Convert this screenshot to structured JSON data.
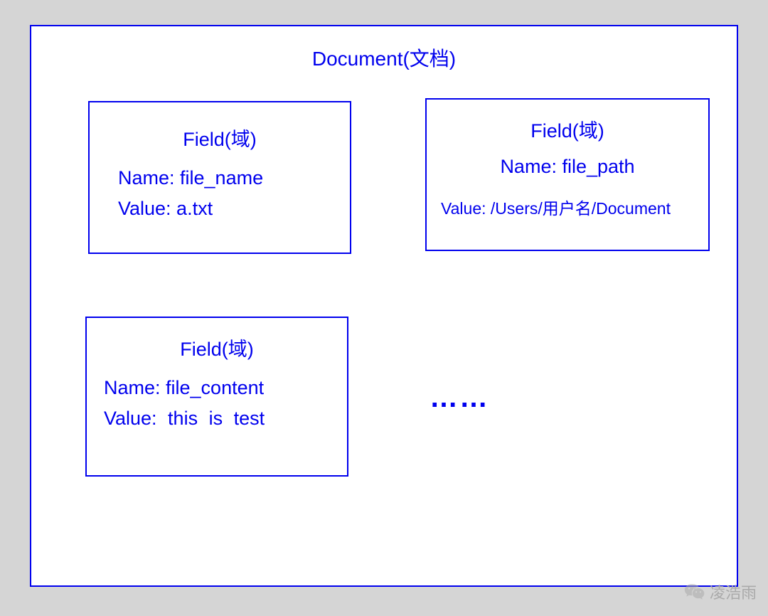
{
  "document": {
    "title": "Document(文档)"
  },
  "fields": [
    {
      "title": "Field(域)",
      "name": "Name: file_name",
      "value": "Value: a.txt"
    },
    {
      "title": "Field(域)",
      "name": "Name: file_path",
      "value": "Value: /Users/用户名/Document"
    },
    {
      "title": "Field(域)",
      "name": "Name: file_content",
      "value": "Value: this  is  test"
    }
  ],
  "ellipsis": "……",
  "watermark": {
    "text": "凌浩雨",
    "icon": "wechat-icon"
  },
  "colors": {
    "border": "#0000ee",
    "text": "#0000ee",
    "background": "#d5d5d5",
    "watermark": "#aaaaaa"
  }
}
